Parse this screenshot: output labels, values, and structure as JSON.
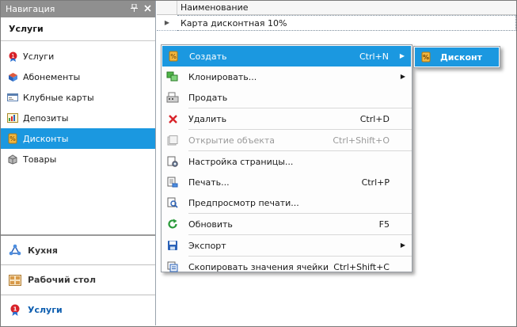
{
  "nav": {
    "header_title": "Навигация",
    "pin_icon": "pin-icon",
    "close_icon": "close-icon",
    "section_title": "Услуги",
    "items": [
      {
        "label": "Услуги",
        "icon": "service-badge-icon",
        "selected": false
      },
      {
        "label": "Абонементы",
        "icon": "subscription-cube-icon",
        "selected": false
      },
      {
        "label": "Клубные карты",
        "icon": "club-card-icon",
        "selected": false
      },
      {
        "label": "Депозиты",
        "icon": "deposit-chart-icon",
        "selected": false
      },
      {
        "label": "Дисконты",
        "icon": "discount-tag-icon",
        "selected": true
      },
      {
        "label": "Товары",
        "icon": "goods-icon",
        "selected": false
      }
    ],
    "bottom_buttons": [
      {
        "label": "Кухня",
        "icon": "kitchen-network-icon",
        "active": false
      },
      {
        "label": "Рабочий стол",
        "icon": "desktop-grid-icon",
        "active": false
      },
      {
        "label": "Услуги",
        "icon": "service-badge-icon",
        "active": true
      }
    ]
  },
  "grid": {
    "column_header": "Наименование",
    "rows": [
      {
        "value": "Карта дисконтная 10%"
      }
    ]
  },
  "context_menu": {
    "items": [
      {
        "label": "Создать",
        "shortcut": "Ctrl+N",
        "icon": "create-icon",
        "submenu": true,
        "highlighted": true,
        "disabled": false
      },
      {
        "label": "Клонировать...",
        "shortcut": "",
        "icon": "clone-icon",
        "submenu": true,
        "highlighted": false,
        "disabled": false
      },
      {
        "label": "Продать",
        "shortcut": "",
        "icon": "sell-register-icon",
        "submenu": false,
        "highlighted": false,
        "disabled": false
      },
      {
        "label": "Удалить",
        "shortcut": "Ctrl+D",
        "icon": "delete-x-icon",
        "submenu": false,
        "highlighted": false,
        "disabled": false
      },
      {
        "label": "Открытие объекта",
        "shortcut": "Ctrl+Shift+O",
        "icon": "open-object-icon",
        "submenu": false,
        "highlighted": false,
        "disabled": true
      },
      {
        "label": "Настройка страницы...",
        "shortcut": "",
        "icon": "page-setup-icon",
        "submenu": false,
        "highlighted": false,
        "disabled": false
      },
      {
        "label": "Печать...",
        "shortcut": "Ctrl+P",
        "icon": "print-icon",
        "submenu": false,
        "highlighted": false,
        "disabled": false
      },
      {
        "label": "Предпросмотр печати...",
        "shortcut": "",
        "icon": "print-preview-icon",
        "submenu": false,
        "highlighted": false,
        "disabled": false
      },
      {
        "label": "Обновить",
        "shortcut": "F5",
        "icon": "refresh-icon",
        "submenu": false,
        "highlighted": false,
        "disabled": false
      },
      {
        "label": "Экспорт",
        "shortcut": "",
        "icon": "export-icon",
        "submenu": true,
        "highlighted": false,
        "disabled": false
      },
      {
        "label": "Скопировать значения ячейки",
        "shortcut": "Ctrl+Shift+C",
        "icon": "copy-cell-icon",
        "submenu": false,
        "highlighted": false,
        "disabled": false
      }
    ]
  },
  "submenu": {
    "label": "Дисконт",
    "icon": "discount-tag-icon"
  },
  "colors": {
    "selection": "#1b98e0",
    "nav_header": "#8f8f8f",
    "active_button_text": "#0f5fb0"
  }
}
